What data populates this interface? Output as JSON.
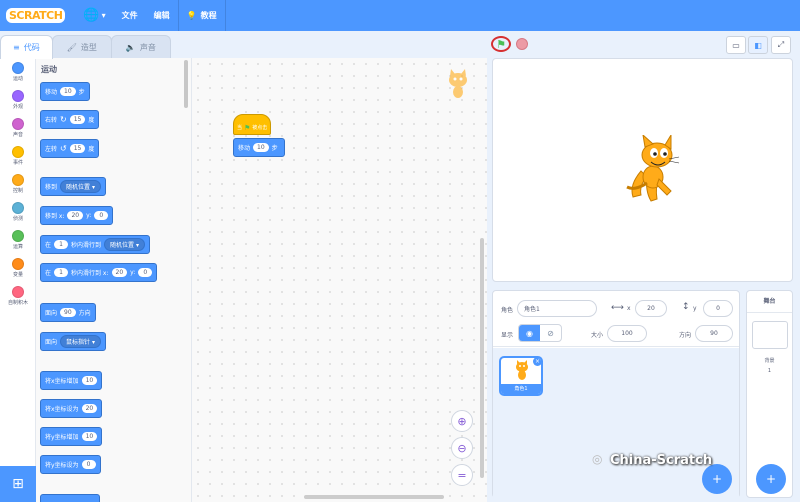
{
  "menubar": {
    "logo": "SCRATCH",
    "file": "文件",
    "edit": "编辑",
    "tutorials": "教程"
  },
  "tabs": {
    "code": "代码",
    "costumes": "造型",
    "sounds": "声音"
  },
  "categories": [
    {
      "label": "运动",
      "color": "#4c97ff"
    },
    {
      "label": "外观",
      "color": "#9966ff"
    },
    {
      "label": "声音",
      "color": "#cf63cf"
    },
    {
      "label": "事件",
      "color": "#ffbf00"
    },
    {
      "label": "控制",
      "color": "#ffab19"
    },
    {
      "label": "侦测",
      "color": "#5cb1d6"
    },
    {
      "label": "运算",
      "color": "#59c059"
    },
    {
      "label": "变量",
      "color": "#ff8c1a"
    },
    {
      "label": "自制积木",
      "color": "#ff6680"
    }
  ],
  "palette": {
    "title": "运动",
    "move": {
      "pre": "移动",
      "val": "10",
      "post": "步"
    },
    "turn_right": {
      "pre": "右转",
      "val": "15",
      "post": "度"
    },
    "turn_left": {
      "pre": "左转",
      "val": "15",
      "post": "度"
    },
    "goto": {
      "pre": "移到",
      "drop": "随机位置"
    },
    "goto_xy": {
      "pre": "移到 x:",
      "x": "20",
      "mid": "y:",
      "y": "0"
    },
    "glide": {
      "pre": "在",
      "val": "1",
      "mid": "秒内滑行到",
      "drop": "随机位置"
    },
    "glide_xy": {
      "pre": "在",
      "val": "1",
      "mid": "秒内滑行到 x:",
      "x": "20",
      "ylab": "y:",
      "y": "0"
    },
    "point_dir": {
      "pre": "面向",
      "val": "90",
      "post": "方向"
    },
    "point_towards": {
      "pre": "面向",
      "drop": "鼠标指针"
    },
    "change_x": {
      "pre": "将x坐标增加",
      "val": "10"
    },
    "set_x": {
      "pre": "将x坐标设为",
      "val": "20"
    },
    "change_y": {
      "pre": "将y坐标增加",
      "val": "10"
    },
    "set_y": {
      "pre": "将y坐标设为",
      "val": "0"
    }
  },
  "workspace": {
    "hat": {
      "pre": "当",
      "post": "被点击"
    },
    "move": {
      "pre": "移动",
      "val": "10",
      "post": "步"
    }
  },
  "sprite_info": {
    "sprite_label": "角色",
    "sprite_name": "角色1",
    "x_label": "x",
    "x": "20",
    "y_label": "y",
    "y": "0",
    "show_label": "显示",
    "size_label": "大小",
    "size": "100",
    "dir_label": "方向",
    "dir": "90"
  },
  "sprite_list": [
    {
      "name": "角色1"
    }
  ],
  "stage_panel": {
    "title": "舞台",
    "backdrops_label": "背景",
    "backdrops_count": "1"
  },
  "watermark": "China-Scratch"
}
